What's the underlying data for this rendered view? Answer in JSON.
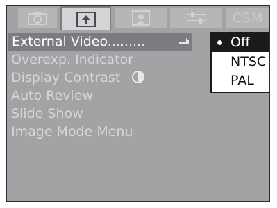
{
  "tabs": [
    {
      "icon": "camera-icon",
      "label": ""
    },
    {
      "icon": "playback-icon",
      "label": "",
      "active": true
    },
    {
      "icon": "portrait-icon",
      "label": ""
    },
    {
      "icon": "settings-sliders-icon",
      "label": ""
    },
    {
      "icon": "",
      "label": "CSM"
    }
  ],
  "menu": {
    "items": [
      {
        "label": "External Video",
        "dots": ".........",
        "selected": true
      },
      {
        "label": "Overexp. Indicator"
      },
      {
        "label": "Display Contrast",
        "icon": "contrast-icon"
      },
      {
        "label": "Auto Review"
      },
      {
        "label": "Slide Show"
      },
      {
        "label": "Image Mode Menu"
      }
    ]
  },
  "popup": {
    "options": [
      {
        "label": "Off",
        "selected": true
      },
      {
        "label": "NTSC"
      },
      {
        "label": "PAL"
      }
    ]
  },
  "colors": {
    "screen_bg": "#a3a3a5",
    "selected_row": "#7c7c80",
    "popup_selected": "#1a1a1a",
    "menu_text": "#d6d6d8"
  }
}
